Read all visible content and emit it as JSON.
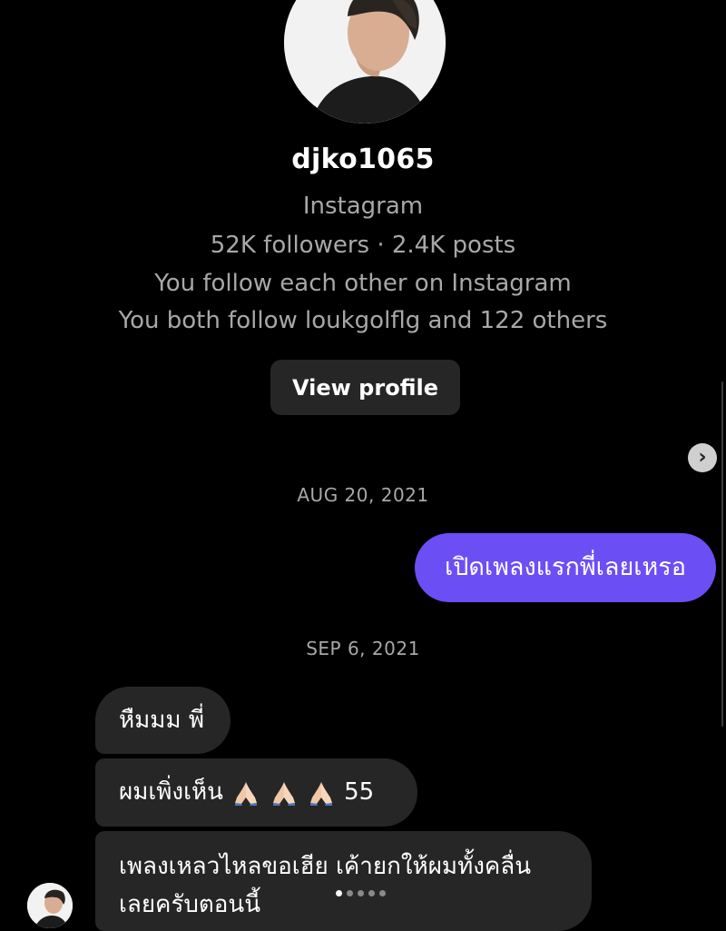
{
  "profile": {
    "username": "djko1065",
    "platform": "Instagram",
    "stats": "52K followers · 2.4K posts",
    "mutual_follow": "You follow each other on Instagram",
    "mutual_friends": "You both follow loukgolflg and 122 others",
    "view_profile_label": "View profile"
  },
  "messages": {
    "date_1": "AUG 20, 2021",
    "sent_1": "เปิดเพลงแรกพี่เลยเหรอ",
    "date_2": "SEP 6, 2021",
    "received_1": "หืมมม พี่",
    "received_2_text": "ผมเพิ่งเห็น",
    "received_2_suffix": "55",
    "received_3_line1": "เพลงเหลวไหลขอเฮีย เค้ายกให้ผมทั้งคลื่น",
    "received_3_line2": "เลยครับตอนนี้"
  },
  "icons": {
    "scroll_button": "chevron-right-icon",
    "reaction": "folded-hands-icon"
  },
  "colors": {
    "background": "#000000",
    "sent_bubble": "#6c4ef5",
    "received_bubble": "#262626",
    "secondary_text": "#a8a8a8"
  }
}
